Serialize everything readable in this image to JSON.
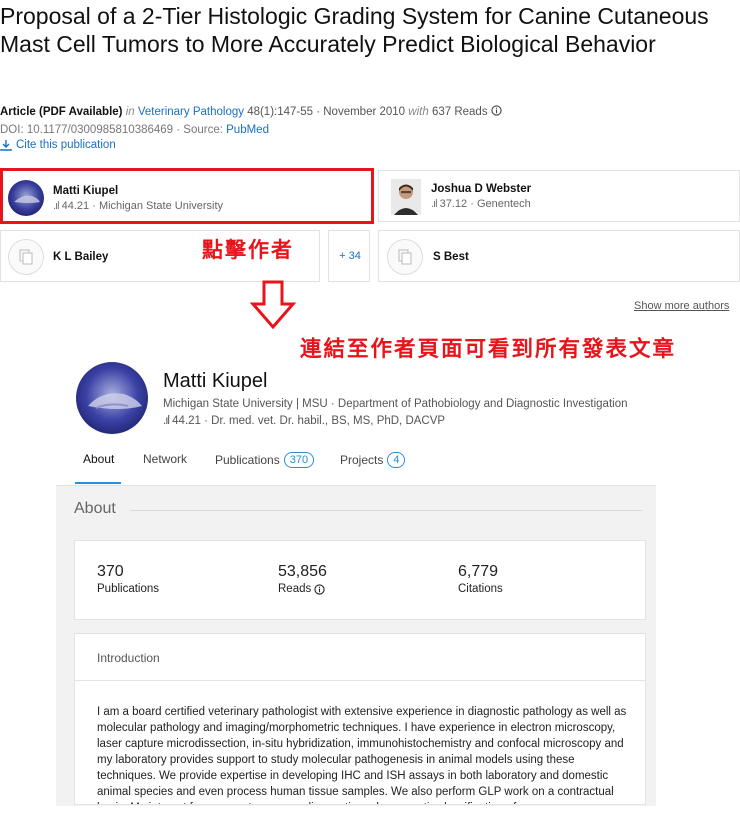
{
  "publication": {
    "title": "Proposal of a 2-Tier Histologic Grading System for Canine Cutaneous Mast Cell Tumors to More Accurately Predict Biological Behavior",
    "type_label": "Article (PDF Available)",
    "in_word": "in",
    "journal": "Veterinary Pathology",
    "volume_pages": "48(1):147-55 · November 2010",
    "with_word": "with",
    "reads": "637 Reads",
    "doi": "DOI: 10.1177/0300985810386469 · Source:",
    "source": "PubMed",
    "cite_label": "Cite this publication"
  },
  "authors": [
    {
      "name": "Matti Kiupel",
      "score": "44.21",
      "affiliation": "Michigan State University"
    },
    {
      "name": "Joshua D Webster",
      "score": "37.12",
      "affiliation": "Genentech"
    },
    {
      "name": "K L Bailey"
    },
    {
      "name": "S Best"
    }
  ],
  "more_count": "+ 34",
  "show_more": "Show more authors",
  "annotations": {
    "click_author": "點擊作者",
    "link_note": "連結至作者頁面可看到所有發表文章"
  },
  "profile": {
    "name": "Matti Kiupel",
    "affiliation": "Michigan State University | MSU · Department of Pathobiology and Diagnostic Investigation",
    "score": "44.21",
    "degrees": "· Dr. med. vet. Dr. habil., BS, MS, PhD, DACVP",
    "tabs": [
      {
        "label": "About"
      },
      {
        "label": "Network"
      },
      {
        "label": "Publications",
        "count": "370"
      },
      {
        "label": "Projects",
        "count": "4"
      }
    ],
    "about_heading": "About",
    "stats": [
      {
        "value": "370",
        "label": "Publications"
      },
      {
        "value": "53,856",
        "label": "Reads"
      },
      {
        "value": "6,779",
        "label": "Citations"
      }
    ],
    "intro_heading": "Introduction",
    "intro_text": "I am a board certified veterinary pathologist with extensive experience in diagnostic pathology as well as molecular pathology and imaging/morphometric techniques. I have experience in electron microscopy, laser capture microdissection, in-situ hybridization, immunohistochemistry and confocal microscopy and my laboratory provides support to study molecular pathogenesis in animal models using these techniques. We provide expertise in developing IHC and ISH assays in both laboratory and domestic animal species and even process human tissue samples. We also perform GLP work on a contractual basis. My interest focuses on two areas: diagnostic and prognostic classification of"
  },
  "colors": {
    "link": "#1a6fc4",
    "annotation_red": "#e8141b",
    "pill_blue": "#2a8fd6"
  }
}
